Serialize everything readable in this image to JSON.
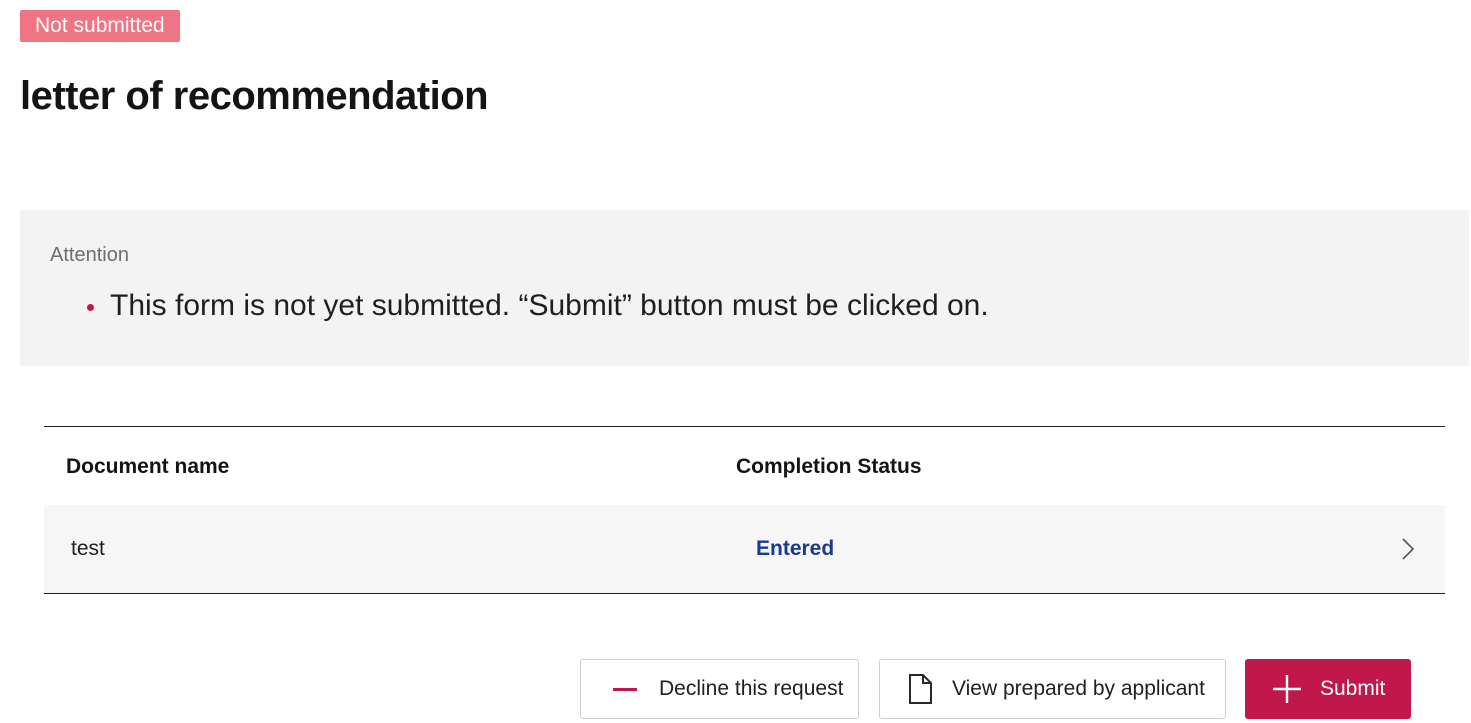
{
  "status_badge": "Not submitted",
  "page_title": "letter of recommendation",
  "notice": {
    "label": "Attention",
    "items": [
      "This form is not yet submitted. “Submit” button must be clicked on."
    ]
  },
  "table": {
    "headers": [
      "Document name",
      "Completion Status"
    ],
    "rows": [
      {
        "name": "test",
        "status": "Entered"
      }
    ]
  },
  "actions": {
    "decline_label": "Decline this request",
    "view_label": "View prepared by applicant",
    "submit_label": "Submit"
  },
  "colors": {
    "accent": "#c0184b",
    "badge": "#ef7484",
    "status_text": "#1b3a8f",
    "notice_bg": "#f3f3f3"
  },
  "icons": {
    "decline": "minus-icon",
    "view": "file-icon",
    "submit": "plus-icon",
    "row": "chevron-right-icon"
  }
}
